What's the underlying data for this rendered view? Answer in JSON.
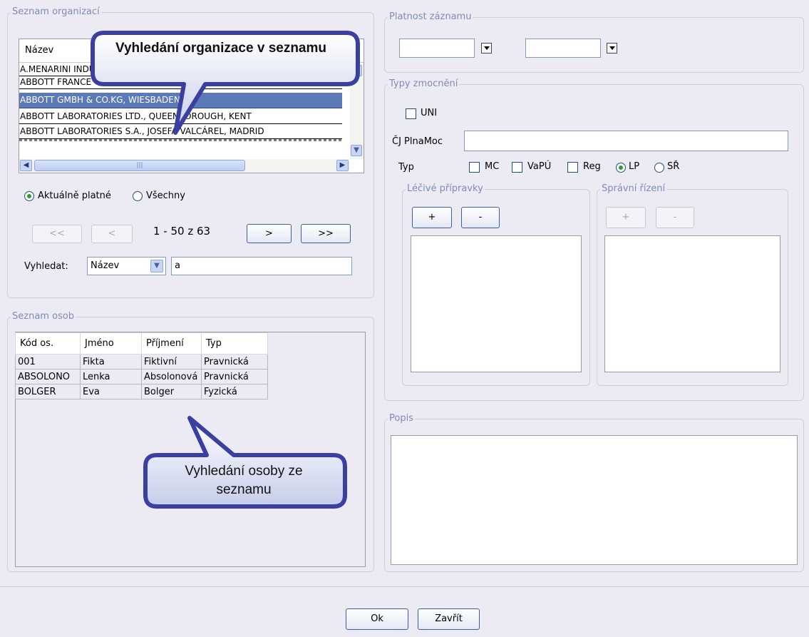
{
  "organizations": {
    "legend": "Seznam organizací",
    "column_header": "Název",
    "rows": [
      "A.MENARINI INDUSTRIE FARMACEUTICHE RIUNITE",
      "ABBOTT FRANCE",
      "ABBOTT GMBH & CO.KG, WIESBADEN",
      "ABBOTT LABORATORIES LTD., QUEENBOROUGH, KENT",
      "ABBOTT LABORATORIES S.A., JOSEFA VALCÁREL, MADRID"
    ],
    "selected_index": 2,
    "filter_current": "Aktuálně platné",
    "filter_all": "Všechny",
    "pager": {
      "first": "<<",
      "prev": "<",
      "info": "1 - 50 z 63",
      "next": ">",
      "last": ">>"
    },
    "search_label": "Vyhledat:",
    "search_field_value": "Název",
    "search_value": "a"
  },
  "persons": {
    "legend": "Seznam osob",
    "headers": [
      "Kód os.",
      "Jméno",
      "Příjmení",
      "Typ"
    ],
    "rows": [
      [
        "001",
        "Fikta",
        "Fiktivní",
        "Pravnická"
      ],
      [
        "ABSOLONO",
        "Lenka",
        "Absolonová",
        "Pravnická"
      ],
      [
        "BOLGER",
        "Eva",
        "Bolger",
        "Fyzická"
      ]
    ]
  },
  "validity": {
    "legend": "Platnost záznamu",
    "from": "",
    "to": ""
  },
  "mandate_types": {
    "legend": "Typy zmocnění",
    "uni_label": "UNI",
    "cj_label": "ČJ PlnaMoc",
    "cj_value": "",
    "type_label": "Typ",
    "checkboxes": [
      "MC",
      "VaPÚ",
      "Reg"
    ],
    "radios": [
      "LP",
      "SŘ"
    ],
    "selected_radio": "LP",
    "drugs": {
      "legend": "Léčivé přípravky",
      "add": "+",
      "remove": "-"
    },
    "proceedings": {
      "legend": "Správní řízení",
      "add": "+",
      "remove": "-"
    }
  },
  "description": {
    "legend": "Popis",
    "value": ""
  },
  "footer": {
    "ok": "Ok",
    "close": "Zavřít"
  },
  "callouts": {
    "organization": "Vyhledání organizace v seznamu",
    "person": "Vyhledání osoby ze seznamu"
  }
}
